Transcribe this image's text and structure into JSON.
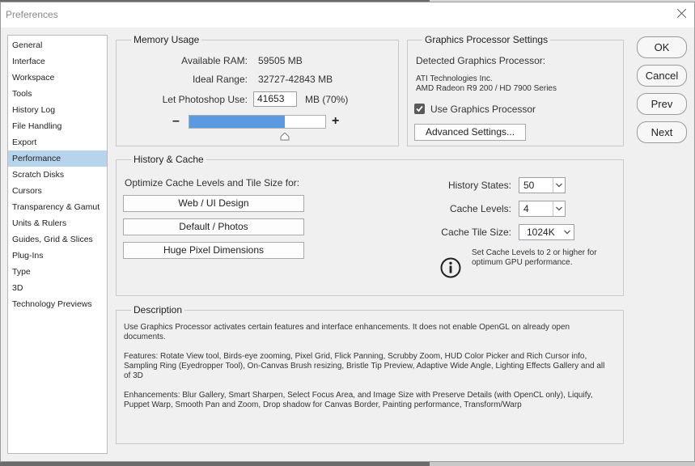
{
  "window": {
    "title": "Preferences"
  },
  "sidebar": {
    "items": [
      {
        "label": "General",
        "selected": false
      },
      {
        "label": "Interface",
        "selected": false
      },
      {
        "label": "Workspace",
        "selected": false
      },
      {
        "label": "Tools",
        "selected": false
      },
      {
        "label": "History Log",
        "selected": false
      },
      {
        "label": "File Handling",
        "selected": false
      },
      {
        "label": "Export",
        "selected": false
      },
      {
        "label": "Performance",
        "selected": true
      },
      {
        "label": "Scratch Disks",
        "selected": false
      },
      {
        "label": "Cursors",
        "selected": false
      },
      {
        "label": "Transparency & Gamut",
        "selected": false
      },
      {
        "label": "Units & Rulers",
        "selected": false
      },
      {
        "label": "Guides, Grid & Slices",
        "selected": false
      },
      {
        "label": "Plug-Ins",
        "selected": false
      },
      {
        "label": "Type",
        "selected": false
      },
      {
        "label": "3D",
        "selected": false
      },
      {
        "label": "Technology Previews",
        "selected": false
      }
    ]
  },
  "memory": {
    "title": "Memory Usage",
    "available_label": "Available RAM:",
    "available_value": "59505 MB",
    "ideal_label": "Ideal Range:",
    "ideal_value": "32727-42843 MB",
    "use_label": "Let Photoshop Use:",
    "use_value": "41653",
    "use_unit": "MB (70%)",
    "slider_fraction": 0.7,
    "minus": "–",
    "plus": "+"
  },
  "gpu": {
    "title": "Graphics Processor Settings",
    "detected_label": "Detected Graphics Processor:",
    "vendor": "ATI Technologies Inc.",
    "model": "AMD Radeon R9 200 / HD 7900 Series",
    "use_gpu_label": "Use Graphics Processor",
    "use_gpu_checked": true,
    "advanced_button": "Advanced Settings..."
  },
  "history_cache": {
    "title": "History & Cache",
    "optimize_label": "Optimize Cache Levels and Tile Size for:",
    "buttons": [
      "Web / UI Design",
      "Default / Photos",
      "Huge Pixel Dimensions"
    ],
    "history_states_label": "History States:",
    "history_states_value": "50",
    "cache_levels_label": "Cache Levels:",
    "cache_levels_value": "4",
    "tile_size_label": "Cache Tile Size:",
    "tile_size_value": "1024K",
    "note_line1": "Set Cache Levels to 2 or higher for",
    "note_line2": "optimum GPU performance."
  },
  "description": {
    "title": "Description",
    "p1": [
      "Use Graphics Processor activates certain features and interface enhancements. It does not enable OpenGL on already open",
      "documents."
    ],
    "p2": [
      "Features: Rotate View tool, Birds-eye zooming, Pixel Grid, Flick Panning, Scrubby Zoom, HUD Color Picker and Rich Cursor info,",
      "Sampling Ring (Eyedropper Tool), On-Canvas Brush resizing, Bristle Tip Preview, Adaptive Wide Angle, Lighting Effects Gallery and all",
      "of 3D"
    ],
    "p3": [
      "Enhancements: Blur Gallery, Smart Sharpen, Select Focus Area, and Image Size with Preserve Details (with OpenCL only), Liquify,",
      "Puppet Warp, Smooth Pan and Zoom, Drop shadow for Canvas Border, Painting performance, Transform/Warp"
    ]
  },
  "actions": {
    "ok": "OK",
    "cancel": "Cancel",
    "prev": "Prev",
    "next": "Next"
  },
  "colors": {
    "slider_fill": "#5b9ae0",
    "selected_item": "#b8d3ec"
  }
}
